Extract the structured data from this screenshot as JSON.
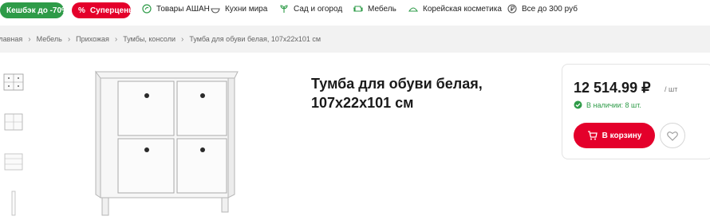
{
  "topbar": {
    "promo_sale": "Кешбэк до -70%",
    "promo_super": "Суперцены",
    "promo_super_icon": "percent-icon",
    "categories": [
      {
        "label": "Товары АШАН",
        "icon": "leaf-circle-icon"
      },
      {
        "label": "Кухни мира",
        "icon": "bowl-icon"
      },
      {
        "label": "Сад и огород",
        "icon": "plant-icon"
      },
      {
        "label": "Мебель",
        "icon": "sofa-icon"
      },
      {
        "label": "Корейская косметика",
        "icon": "lotus-icon"
      },
      {
        "label": "Все до 300 руб",
        "icon": "ruble-coin-icon"
      }
    ]
  },
  "breadcrumb": [
    "Главная",
    "Мебель",
    "Прихожая",
    "Тумбы, консоли",
    "Тумба для обуви белая, 107x22x101 см"
  ],
  "product": {
    "title": "Тумба для обуви белая, 107x22x101 см",
    "price": "12 514.99 ₽",
    "unit": "/ шт",
    "stock": "В наличии: 8 шт.",
    "cart_label": "В корзину"
  },
  "colors": {
    "brand_red": "#e4002b",
    "brand_green": "#2e9b48",
    "breadcrumb_bg": "#f2f2f2"
  }
}
